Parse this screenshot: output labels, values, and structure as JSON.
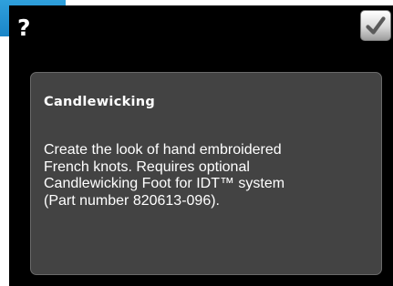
{
  "dialog": {
    "help_symbol": "?",
    "confirm_button": {
      "icon": "checkmark-icon",
      "state": "enabled"
    },
    "info": {
      "title": "Candlewicking",
      "body": "Create the look of hand embroidered\nFrench knots. Requires optional\nCandlewicking Foot for IDT™ system\n(Part number 820613-096)."
    }
  },
  "colors": {
    "dialog_background": "#000000",
    "panel_background": "#434343",
    "panel_border": "#6a6a6a",
    "accent": "#1b86c8",
    "text": "#ffffff"
  }
}
